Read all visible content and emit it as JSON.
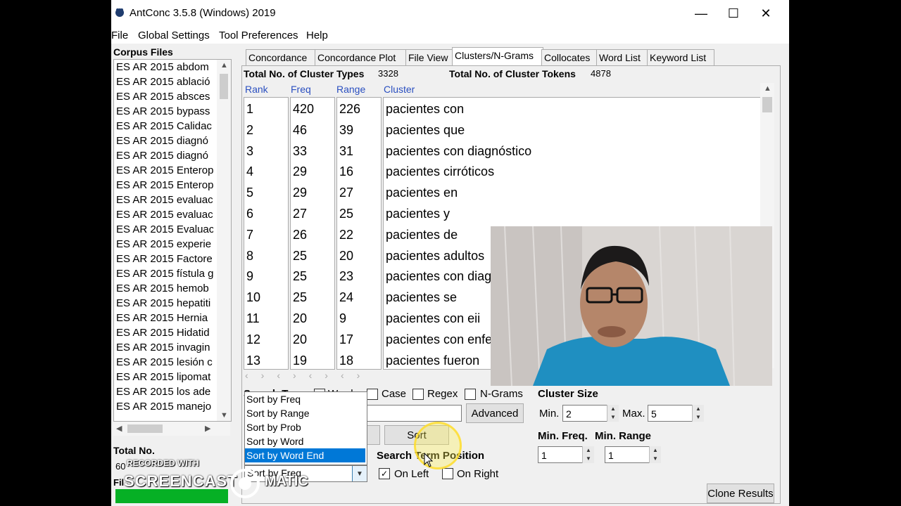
{
  "window": {
    "title": "AntConc 3.5.8 (Windows) 2019",
    "controls": {
      "minimize": "—",
      "maximize": "☐",
      "close": "✕"
    }
  },
  "menu": [
    "File",
    "Global Settings",
    "Tool Preferences",
    "Help"
  ],
  "corpus": {
    "title": "Corpus Files",
    "files": [
      "ES AR 2015 abdom",
      "ES AR 2015 ablació",
      "ES AR 2015 absces",
      "ES AR 2015 bypass",
      "ES AR 2015 Calidac",
      "ES AR 2015 diagnó",
      "ES AR 2015 diagnó",
      "ES AR 2015 Enterop",
      "ES AR 2015 Enterop",
      "ES AR 2015 evaluac",
      "ES AR 2015 evaluac",
      "ES AR 2015 Evaluac",
      "ES AR 2015 experie",
      "ES AR 2015 Factore",
      "ES AR 2015 fístula g",
      "ES AR 2015 hemob",
      "ES AR 2015 hepatiti",
      "ES AR 2015 Hernia",
      "ES AR 2015 Hidatid",
      "ES AR 2015 invagin",
      "ES AR 2015 lesión c",
      "ES AR 2015 lipomat",
      "ES AR 2015 los ade",
      "ES AR 2015 manejo"
    ],
    "total_label": "Total No.",
    "total_value": "60",
    "files_label": "Fil"
  },
  "tabs": [
    "Concordance",
    "Concordance Plot",
    "File View",
    "Clusters/N-Grams",
    "Collocates",
    "Word List",
    "Keyword List"
  ],
  "active_tab": "Clusters/N-Grams",
  "stats": {
    "types_label": "Total No. of Cluster Types",
    "types_value": "3328",
    "tokens_label": "Total No. of Cluster Tokens",
    "tokens_value": "4878"
  },
  "columns": [
    "Rank",
    "Freq",
    "Range",
    "Cluster"
  ],
  "rows": [
    {
      "rank": "1",
      "freq": "420",
      "range": "226",
      "cluster": "pacientes con"
    },
    {
      "rank": "2",
      "freq": "46",
      "range": "39",
      "cluster": "pacientes que"
    },
    {
      "rank": "3",
      "freq": "33",
      "range": "31",
      "cluster": "pacientes con diagnóstico"
    },
    {
      "rank": "4",
      "freq": "29",
      "range": "16",
      "cluster": "pacientes cirróticos"
    },
    {
      "rank": "5",
      "freq": "29",
      "range": "27",
      "cluster": "pacientes en"
    },
    {
      "rank": "6",
      "freq": "27",
      "range": "25",
      "cluster": "pacientes y"
    },
    {
      "rank": "7",
      "freq": "26",
      "range": "22",
      "cluster": "pacientes de"
    },
    {
      "rank": "8",
      "freq": "25",
      "range": "20",
      "cluster": "pacientes adultos"
    },
    {
      "rank": "9",
      "freq": "25",
      "range": "23",
      "cluster": "pacientes con diag"
    },
    {
      "rank": "10",
      "freq": "25",
      "range": "24",
      "cluster": "pacientes se"
    },
    {
      "rank": "11",
      "freq": "20",
      "range": "9",
      "cluster": "pacientes con eii"
    },
    {
      "rank": "12",
      "freq": "20",
      "range": "17",
      "cluster": "pacientes con enfe"
    },
    {
      "rank": "13",
      "freq": "19",
      "range": "18",
      "cluster": "pacientes fueron"
    }
  ],
  "search": {
    "label": "Search Te",
    "words": "Words",
    "case": "Case",
    "regex": "Regex",
    "ngrams": "N-Grams",
    "advanced": "Advanced",
    "sort_button": "Sort",
    "term_position": "Search Term Position",
    "on_left": "On Left",
    "on_right": "On Right"
  },
  "sort_options": [
    "Sort by Freq",
    "Sort by Range",
    "Sort by Prob",
    "Sort by Word",
    "Sort by Word End"
  ],
  "sort_selected_index": 4,
  "sort_combo_value": "Sort by Freq",
  "cluster": {
    "size_label": "Cluster Size",
    "min_label": "Min.",
    "min_value": "2",
    "max_label": "Max.",
    "max_value": "5",
    "min_freq_label": "Min. Freq.",
    "min_freq_value": "1",
    "min_range_label": "Min. Range",
    "min_range_value": "1"
  },
  "clone_button": "Clone Results",
  "watermark": {
    "line1": "RECORDED WITH",
    "line2": "SCREENCAST",
    "line3": "MATIC"
  }
}
